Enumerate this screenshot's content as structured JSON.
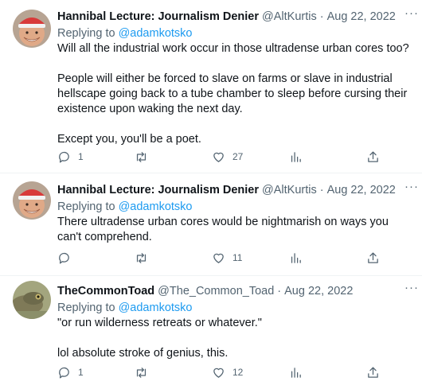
{
  "tweets": [
    {
      "author_name": "Hannibal Lecture: Journalism Denier",
      "handle": "@AltKurtis",
      "separator": "·",
      "date": "Aug 22, 2022",
      "more": "···",
      "replying_prefix": "Replying to ",
      "replying_to": "@adamkotsko",
      "text": "Will all the industrial work occur in those ultradense urban cores too?\n\nPeople will either be forced to slave on farms or slave in industrial hellscape going back to a tube chamber to sleep before cursing their existence upon waking the next day.\n\nExcept you, you'll be a poet.",
      "reply_count": "1",
      "retweet_count": "",
      "like_count": "27",
      "avatar_icon": "santa-hat-avatar"
    },
    {
      "author_name": "Hannibal Lecture: Journalism Denier",
      "handle": "@AltKurtis",
      "separator": "·",
      "date": "Aug 22, 2022",
      "more": "···",
      "replying_prefix": "Replying to ",
      "replying_to": "@adamkotsko",
      "text": "There ultradense urban cores would be nightmarish on ways you can't comprehend.",
      "reply_count": "",
      "retweet_count": "",
      "like_count": "11",
      "avatar_icon": "santa-hat-avatar"
    },
    {
      "author_name": "TheCommonToad",
      "handle": "@The_Common_Toad",
      "separator": "·",
      "date": "Aug 22, 2022",
      "more": "···",
      "replying_prefix": "Replying to ",
      "replying_to": "@adamkotsko",
      "text": "\"or run wilderness retreats or whatever.\"\n\nlol absolute stroke of genius, this.",
      "reply_count": "1",
      "retweet_count": "",
      "like_count": "12",
      "avatar_icon": "toad-avatar"
    }
  ],
  "colors": {
    "link": "#1d9bf0",
    "secondary_text": "#536471",
    "primary_text": "#0f1419",
    "divider": "#eff3f4"
  }
}
